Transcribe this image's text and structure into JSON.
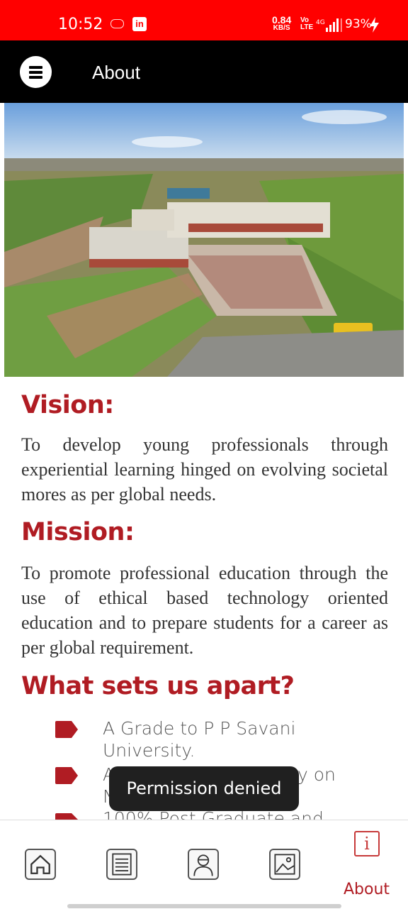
{
  "status_bar": {
    "time": "10:52",
    "speed_value": "0.84",
    "speed_unit": "KB/S",
    "volte": "Vo LTE",
    "network": "4G",
    "battery": "93%"
  },
  "app_bar": {
    "title": "About"
  },
  "sections": {
    "vision_heading": "Vision:",
    "vision_text": "To develop young professionals through experiential learning hinged on evolving societal mores as per global needs.",
    "mission_heading": "Mission:",
    "mission_text": "To promote professional education through the use of ethical based technology oriented education and to prepare students for a career as per global requirement.",
    "apart_heading": "What sets us apart?",
    "apart_items": [
      "A Grade to P P Savani University.",
      "A",
      "y on",
      "N",
      "100% Post Graduate and"
    ]
  },
  "toast": {
    "message": "Permission denied"
  },
  "bottom_nav": {
    "about_label": "About",
    "about_icon_glyph": "i"
  },
  "colors": {
    "status_bar": "#ff0000",
    "app_bar": "#000000",
    "accent": "#b01c23"
  }
}
